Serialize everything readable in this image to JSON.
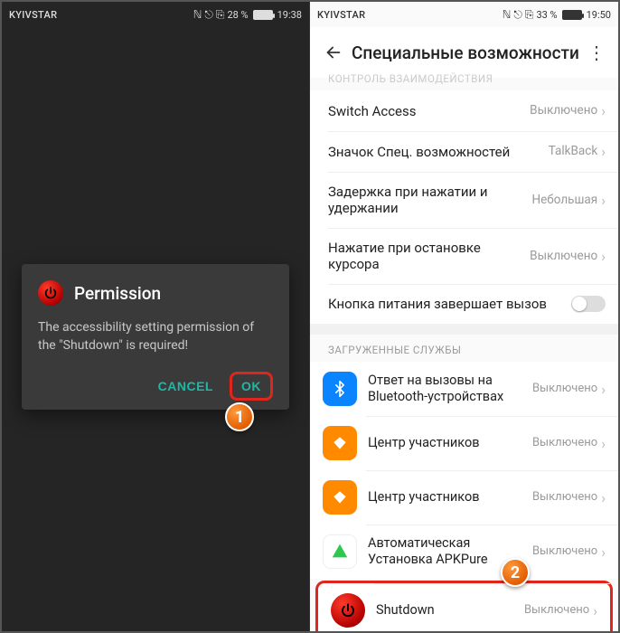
{
  "left": {
    "status": {
      "carrier": "KYIVSTAR",
      "battery_pct": "28 %",
      "time": "19:38",
      "batt_fill": "28%"
    },
    "dialog": {
      "title": "Permission",
      "message": "The accessibility setting permission of the \"Shutdown\" is required!",
      "cancel": "CANCEL",
      "ok": "OK"
    }
  },
  "right": {
    "status": {
      "carrier": "KYIVSTAR",
      "battery_pct": "33 %",
      "time": "19:50",
      "batt_fill": "33%"
    },
    "appbar": {
      "title": "Специальные возможности"
    },
    "section_top_cut": "КОНТРОЛЬ ВЗАИМОДЕЙСТВИЯ",
    "rows": {
      "switch_access": {
        "label": "Switch Access",
        "value": "Выключено"
      },
      "shortcut": {
        "label": "Значок Спец. возможностей",
        "value": "TalkBack"
      },
      "delay": {
        "label": "Задержка при нажатии и удержании",
        "value": "Небольшая"
      },
      "cursor_stop": {
        "label": "Нажатие при остановке курсора",
        "value": "Выключено"
      },
      "power_end": {
        "label": "Кнопка питания завершает вызов"
      }
    },
    "section_services": "ЗАГРУЖЕННЫЕ СЛУЖБЫ",
    "services": {
      "bt": {
        "label": "Ответ на вызовы на Bluetooth-устройствах",
        "value": "Выключено"
      },
      "cu1": {
        "label": "Центр участников",
        "value": "Выключено"
      },
      "cu2": {
        "label": "Центр участников",
        "value": "Выключено"
      },
      "apk": {
        "label": "Автоматическая Установка APKPure",
        "value": "Выключено"
      },
      "shut": {
        "label": "Shutdown",
        "value": "Выключено"
      }
    }
  },
  "badges": {
    "n1": "1",
    "n2": "2"
  }
}
